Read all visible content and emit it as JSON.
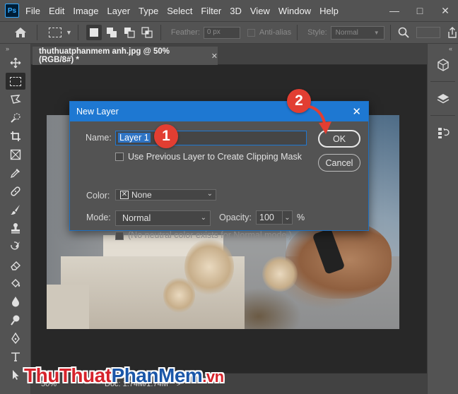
{
  "app": {
    "logo": "Ps",
    "menu": [
      "File",
      "Edit",
      "Image",
      "Layer",
      "Type",
      "Select",
      "Filter",
      "3D",
      "View",
      "Window",
      "Help"
    ],
    "window_controls": {
      "minimize": "—",
      "maximize": "□",
      "close": "✕"
    }
  },
  "options_bar": {
    "feather_label": "Feather:",
    "feather_value": "0 px",
    "antialias_label": "Anti-alias",
    "style_label": "Style:",
    "style_value": "Normal"
  },
  "document_tab": {
    "title": "thuthuatphanmem anh.jpg @ 50% (RGB/8#) *",
    "close": "✕"
  },
  "status_bar": {
    "zoom": "50%",
    "doc_info": "Doc: 1.74M/1.74M",
    "arrow": ">"
  },
  "dialog": {
    "title": "New Layer",
    "close": "✕",
    "name_label": "Name:",
    "name_value": "Layer 1",
    "clipping_label": "Use Previous Layer to Create Clipping Mask",
    "color_label": "Color:",
    "color_value": "None",
    "mode_label": "Mode:",
    "mode_value": "Normal",
    "opacity_label": "Opacity:",
    "opacity_value": "100",
    "opacity_unit": "%",
    "neutral_label": "(No neutral color exists for Normal mode.)",
    "ok_label": "OK",
    "cancel_label": "Cancel"
  },
  "markers": {
    "step1": "1",
    "step2": "2"
  },
  "watermark": {
    "part1": "Thu",
    "part2": "Thuat",
    "part3": "Phan",
    "part4": "Mem",
    "part5": ".vn"
  },
  "colors": {
    "accent": "#1e78d2",
    "marker": "#e23e32",
    "panel": "#535353",
    "canvas": "#282828"
  }
}
